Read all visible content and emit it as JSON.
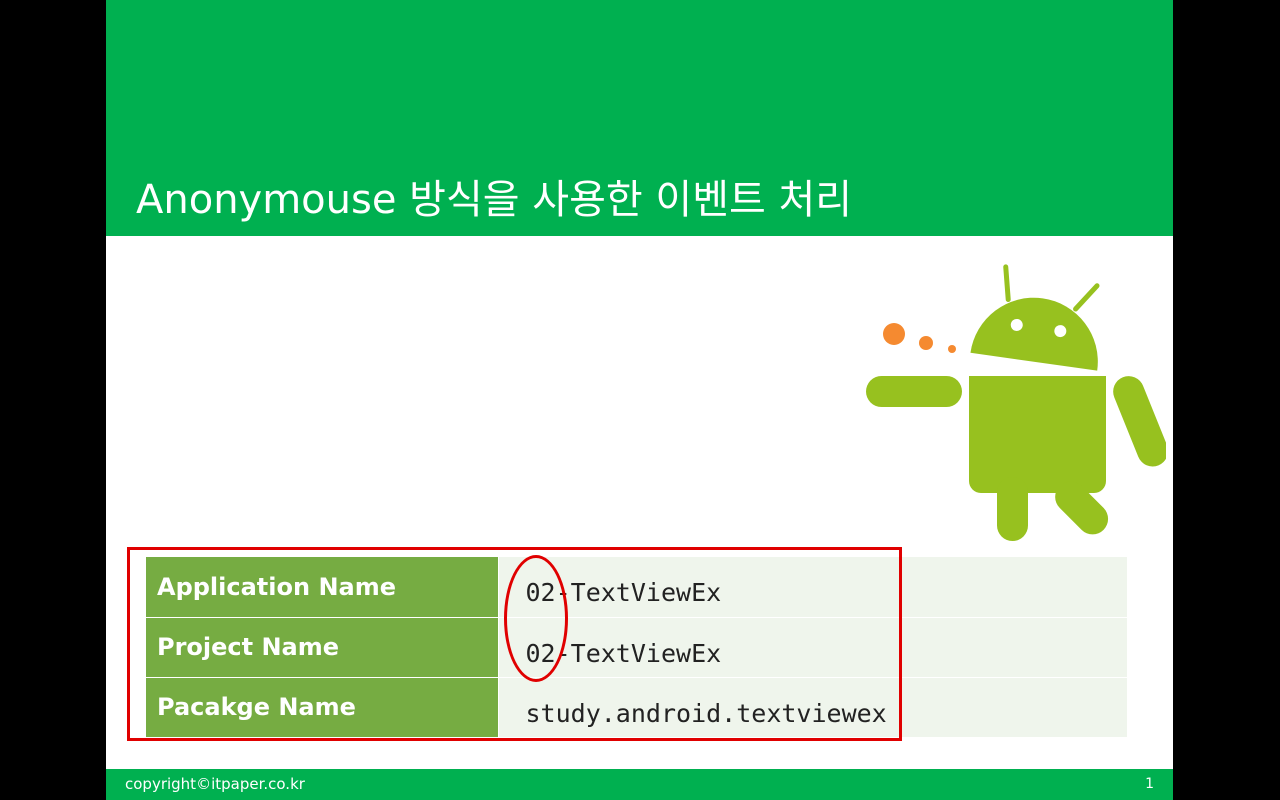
{
  "slide": {
    "title": "Anonymouse 방식을 사용한 이벤트 처리",
    "table": [
      {
        "label": "Application Name",
        "value": "02-TextViewEx"
      },
      {
        "label": "Project Name",
        "value": "02-TextViewEx"
      },
      {
        "label": "Pacakge Name",
        "value": "study.android.textviewex"
      }
    ],
    "footer": {
      "copyright": "copyright©itpaper.co.kr",
      "page_number": "1"
    }
  },
  "colors": {
    "header_green": "#00b050",
    "label_green": "#76ac42",
    "value_bg": "#eff5ec",
    "highlight_red": "#e00000",
    "android_green": "#97c11f",
    "dots_orange": "#f58a30"
  },
  "icons": [
    "android-robot-icon"
  ]
}
